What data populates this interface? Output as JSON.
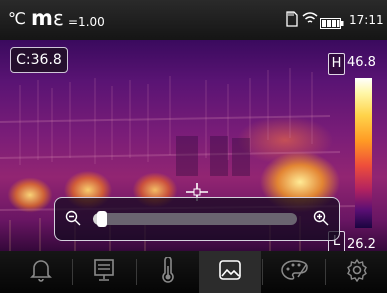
{
  "status": {
    "unit": "℃",
    "mode": "m",
    "emissivity_symbol": "ε",
    "emissivity": "=1.00",
    "time": "17:11",
    "icons": [
      "sd-card-icon",
      "wifi-icon",
      "battery-icon"
    ]
  },
  "readouts": {
    "center": "C:36.8",
    "high_label": "H",
    "high_value": "46.8",
    "low_label": "L",
    "low_value": "26.2"
  },
  "palette": {
    "name": "iron",
    "colors": [
      "#ffffff",
      "#ffd34a",
      "#ff9a24",
      "#ef4f3a",
      "#b4235f",
      "#5a0f74",
      "#1a0440"
    ]
  },
  "zoom": {
    "level_fraction": 0.02
  },
  "toolbar": {
    "items": [
      {
        "icon": "alarm-bell-icon"
      },
      {
        "icon": "display-icon"
      },
      {
        "icon": "thermometer-icon"
      },
      {
        "icon": "image-gallery-icon",
        "selected": true
      },
      {
        "icon": "palette-icon"
      },
      {
        "icon": "settings-gear-icon"
      }
    ]
  }
}
